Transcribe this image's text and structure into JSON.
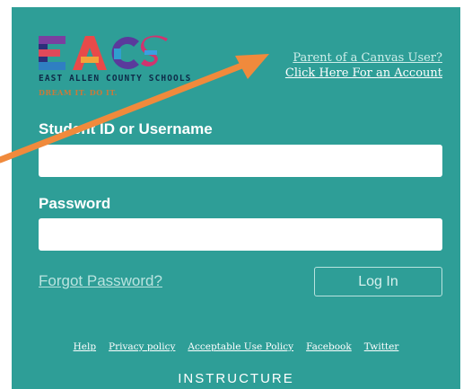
{
  "logo": {
    "letters": "EACS",
    "name": "EAST ALLEN COUNTY SCHOOLS",
    "tagline": "DREAM IT. DO IT."
  },
  "parent_link": {
    "line1": "Parent of a Canvas User?",
    "line2": "Click Here For an Account"
  },
  "form": {
    "username_label": "Student ID or Username",
    "username_value": "",
    "password_label": "Password",
    "password_value": "",
    "forgot_password": "Forgot Password?",
    "login_button": "Log In"
  },
  "footer": {
    "links": [
      "Help",
      "Privacy policy",
      "Acceptable Use Policy",
      "Facebook",
      "Twitter"
    ],
    "brand": "INSTRUCTURE"
  },
  "colors": {
    "background": "#2e9e97",
    "annotation_arrow": "#f08a3c"
  },
  "icons": [
    "annotation-arrow-icon"
  ]
}
